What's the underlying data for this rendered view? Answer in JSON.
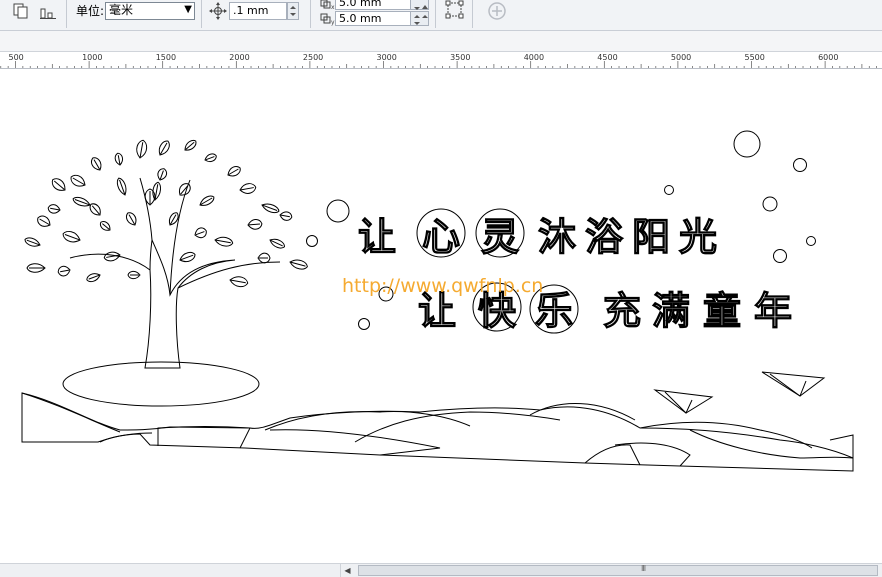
{
  "toolbar": {
    "unit_label": "单位:",
    "unit_value": "毫米",
    "nudge_value": ".1 mm",
    "dup_x_value": "5.0 mm",
    "dup_y_value": "5.0 mm",
    "icons": [
      "pages-icon",
      "align-icon",
      "dropdown-arrow-icon",
      "nudge-icon",
      "duplicate-distance-x-icon",
      "duplicate-distance-y-icon",
      "transform-object-icon",
      "add-icon"
    ]
  },
  "ruler": {
    "labels": [
      "500",
      "1000",
      "1500",
      "2000",
      "2500",
      "3000",
      "3500",
      "4000",
      "4500",
      "5000",
      "5500",
      "6000"
    ]
  },
  "drawing": {
    "line1": [
      "让",
      "心",
      "灵",
      "沐",
      "浴",
      "阳",
      "光"
    ],
    "line2": [
      "让",
      "快",
      "乐",
      "充",
      "满",
      "童",
      "年"
    ],
    "watermark": "http://www.qwfnlp.cn"
  },
  "scrollbar": {
    "grip": "III"
  },
  "colors": {
    "watermark": "#f4a11a",
    "toolbar_bg": "#f1f3f6"
  }
}
